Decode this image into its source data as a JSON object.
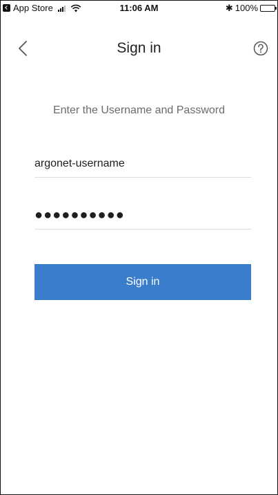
{
  "status_bar": {
    "back_app_label": "App Store",
    "time": "11:06 AM",
    "bluetooth_glyph": "✱",
    "battery_percent": "100%"
  },
  "nav": {
    "title": "Sign in",
    "back_icon": "chevron-left-icon",
    "help_icon": "help-circle-icon"
  },
  "form": {
    "instruction": "Enter the Username and Password",
    "username_value": "argonet-username",
    "password_value": "●●●●●●●●●●",
    "submit_label": "Sign in"
  },
  "colors": {
    "primary_button": "#3a7ecb",
    "instruction_text": "#6b6b6b",
    "divider": "#dcdcdc"
  }
}
